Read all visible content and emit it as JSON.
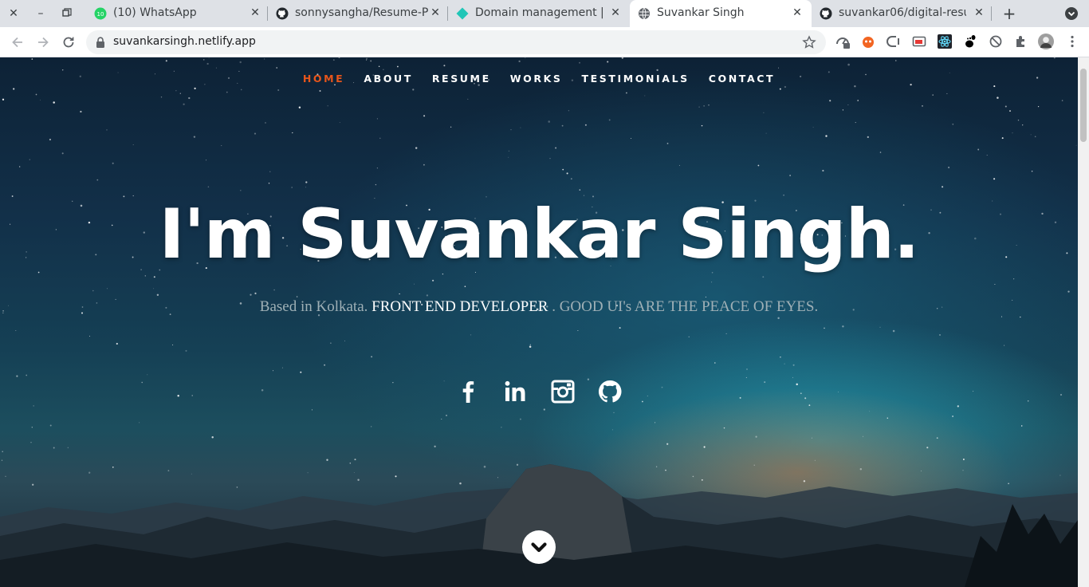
{
  "browser": {
    "tabs": [
      {
        "title": "(10) WhatsApp",
        "badge": "10"
      },
      {
        "title": "sonnysangha/Resume-P"
      },
      {
        "title": "Domain management | S"
      },
      {
        "title": "Suvankar Singh"
      },
      {
        "title": "suvankar06/digital-resu"
      }
    ],
    "url": "suvankarsingh.netlify.app",
    "colors": {
      "accent": "#e8551b",
      "whatsapp": "#25d366",
      "netlify": "#20c6b7"
    }
  },
  "nav": {
    "items": [
      "HOME",
      "ABOUT",
      "RESUME",
      "WORKS",
      "TESTIMONIALS",
      "CONTACT"
    ]
  },
  "hero": {
    "title": "I'm Suvankar Singh.",
    "sub_pre": "Based in Kolkata. ",
    "sub_highlight": "FRONT END DEVELOPER",
    "sub_post": " . GOOD UI's ARE THE PEACE OF EYES."
  },
  "social": {
    "icons": [
      "facebook-icon",
      "linkedin-icon",
      "instagram-icon",
      "github-icon"
    ]
  }
}
